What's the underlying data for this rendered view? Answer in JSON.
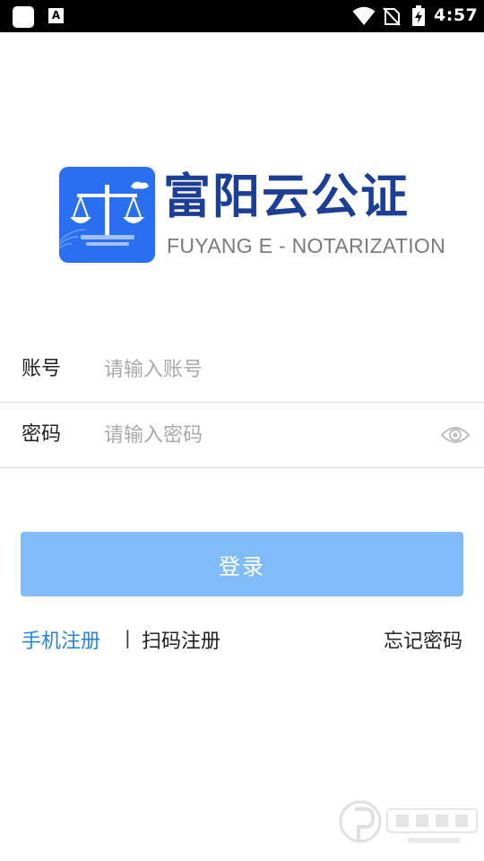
{
  "status_bar": {
    "time": "4:57",
    "app_badge": "A",
    "icons": [
      "app-square-icon",
      "app-a-icon",
      "wifi-icon",
      "no-sim-icon",
      "battery-charging-icon"
    ]
  },
  "brand": {
    "title": "富阳云公证",
    "subtitle": "FUYANG E - NOTARIZATION",
    "logo_icon": "scales-of-justice-icon",
    "logo_color": "#2a6ff0",
    "title_color": "#1c3f95"
  },
  "form": {
    "account": {
      "label": "账号",
      "placeholder": "请输入账号",
      "value": ""
    },
    "password": {
      "label": "密码",
      "placeholder": "请输入密码",
      "value": "",
      "toggle_icon": "eye-icon"
    }
  },
  "login_button": {
    "label": "登录",
    "color": "#80bdf8"
  },
  "links": {
    "phone_register": "手机注册",
    "separator": "|",
    "scan_register": "扫码注册",
    "forgot_password": "忘记密码",
    "accent_color": "#2a83d7"
  },
  "watermark": {
    "icon": "watermark-logo-icon"
  }
}
